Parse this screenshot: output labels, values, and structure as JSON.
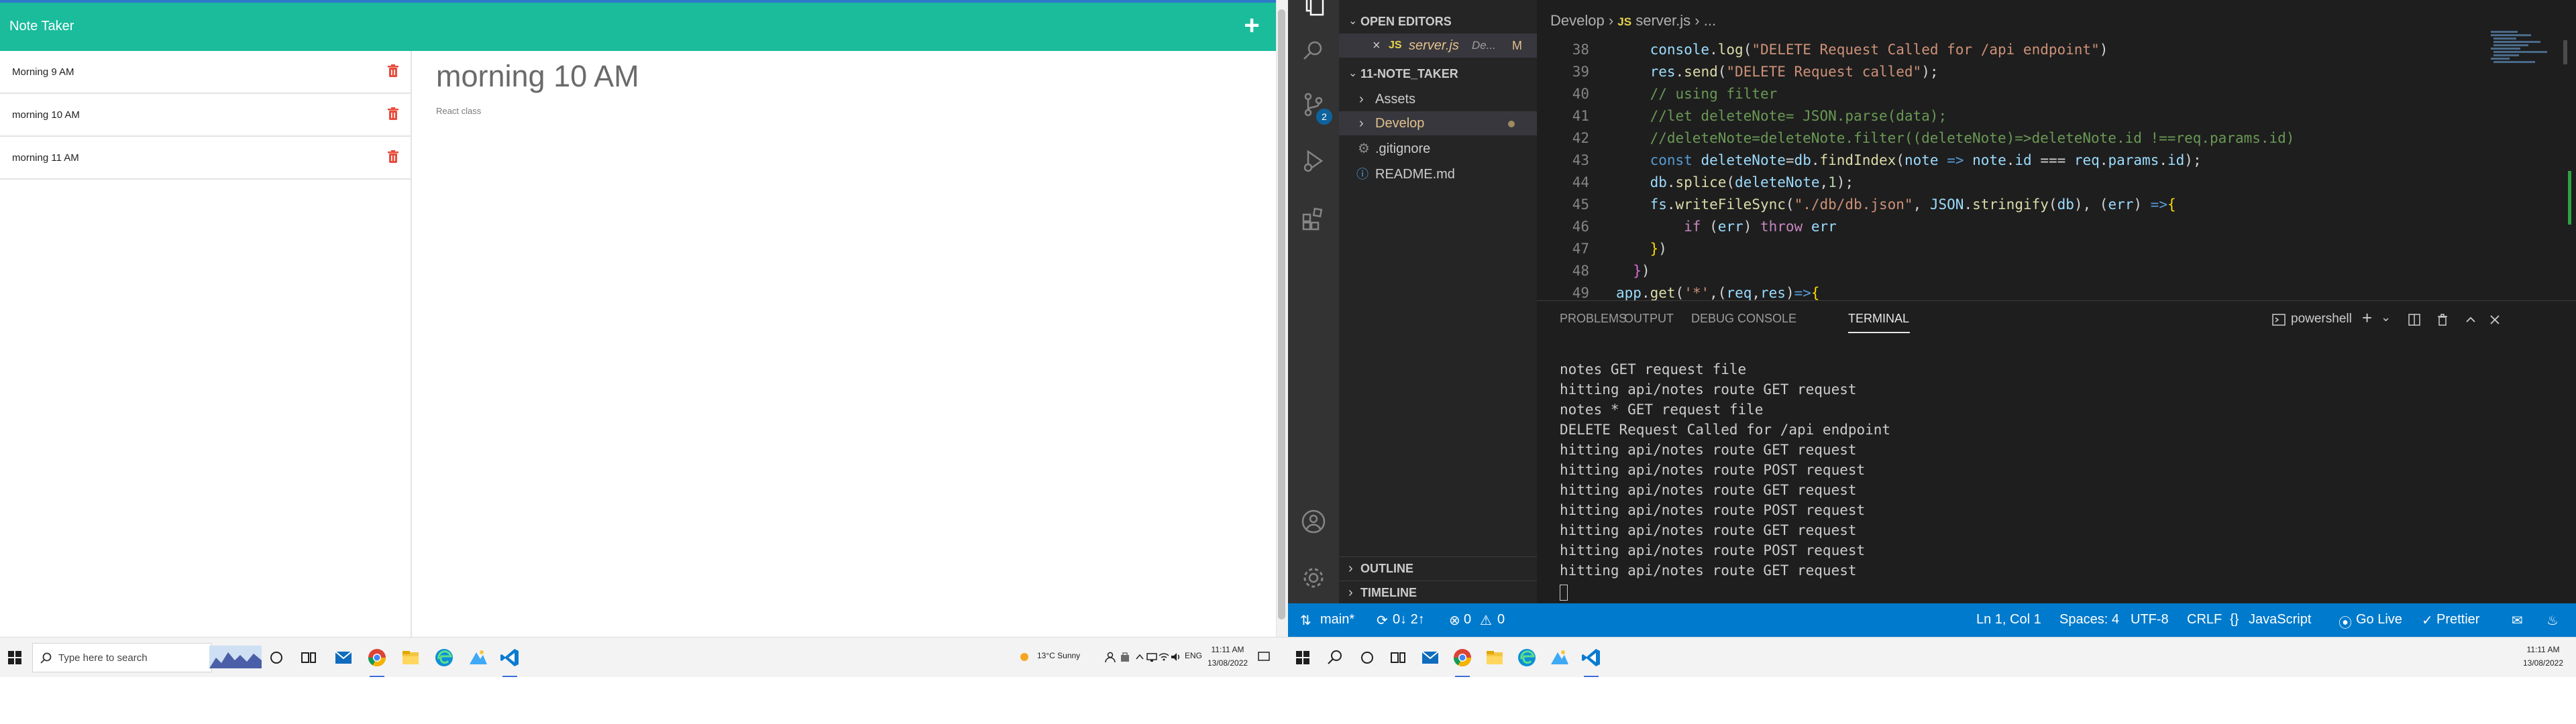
{
  "note_app": {
    "title": "Note Taker",
    "add_symbol": "+",
    "notes": [
      {
        "title": "Morning 9 AM"
      },
      {
        "title": "morning 10 AM"
      },
      {
        "title": "morning 11 AM"
      }
    ],
    "active_note": {
      "title": "morning 10 AM",
      "text": "React class"
    }
  },
  "taskbar_left": {
    "search_placeholder": "Type here to search",
    "weather": "13°C  Sunny",
    "lang": "ENG",
    "time": "11:11 AM",
    "date": "13/08/2022"
  },
  "taskbar_right": {
    "time": "11:11 AM",
    "date": "13/08/2022"
  },
  "vscode": {
    "explorer": {
      "open_editors_label": "OPEN EDITORS",
      "open_file": "server.js",
      "open_file_path": "De...",
      "open_file_badge": "M",
      "project_label": "11-NOTE_TAKER",
      "items": [
        "Assets",
        "Develop",
        ".gitignore",
        "README.md"
      ],
      "outline_label": "OUTLINE",
      "timeline_label": "TIMELINE"
    },
    "source_control_badge": "2",
    "breadcrumb": {
      "folder": "Develop",
      "file_icon": "JS",
      "file": "server.js",
      "more": "..."
    },
    "line_numbers": [
      "38",
      "39",
      "40",
      "41",
      "42",
      "43",
      "44",
      "45",
      "46",
      "47",
      "48",
      "49"
    ],
    "panel_tabs": [
      "PROBLEMS",
      "OUTPUT",
      "DEBUG CONSOLE",
      "TERMINAL"
    ],
    "terminal_shell": "powershell",
    "terminal_lines": [
      "notes GET request file",
      "hitting api/notes route GET request",
      "notes * GET request file",
      "DELETE Request Called for /api endpoint",
      "hitting api/notes route GET request",
      "hitting api/notes route POST request",
      "hitting api/notes route GET request",
      "hitting api/notes route POST request",
      "hitting api/notes route GET request",
      "hitting api/notes route POST request",
      "hitting api/notes route GET request"
    ],
    "status": {
      "branch": "main*",
      "sync": "0↓ 2↑",
      "errors": "0",
      "warnings": "0",
      "position": "Ln 1, Col 1",
      "spaces": "Spaces: 4",
      "encoding": "UTF-8",
      "eol": "CRLF",
      "language": "JavaScript",
      "golive": "Go Live",
      "prettier": "Prettier"
    }
  },
  "colors": {
    "note_header": "#1abc9c",
    "vscode_status": "#007acc",
    "delete_icon": "#e74c3c"
  }
}
